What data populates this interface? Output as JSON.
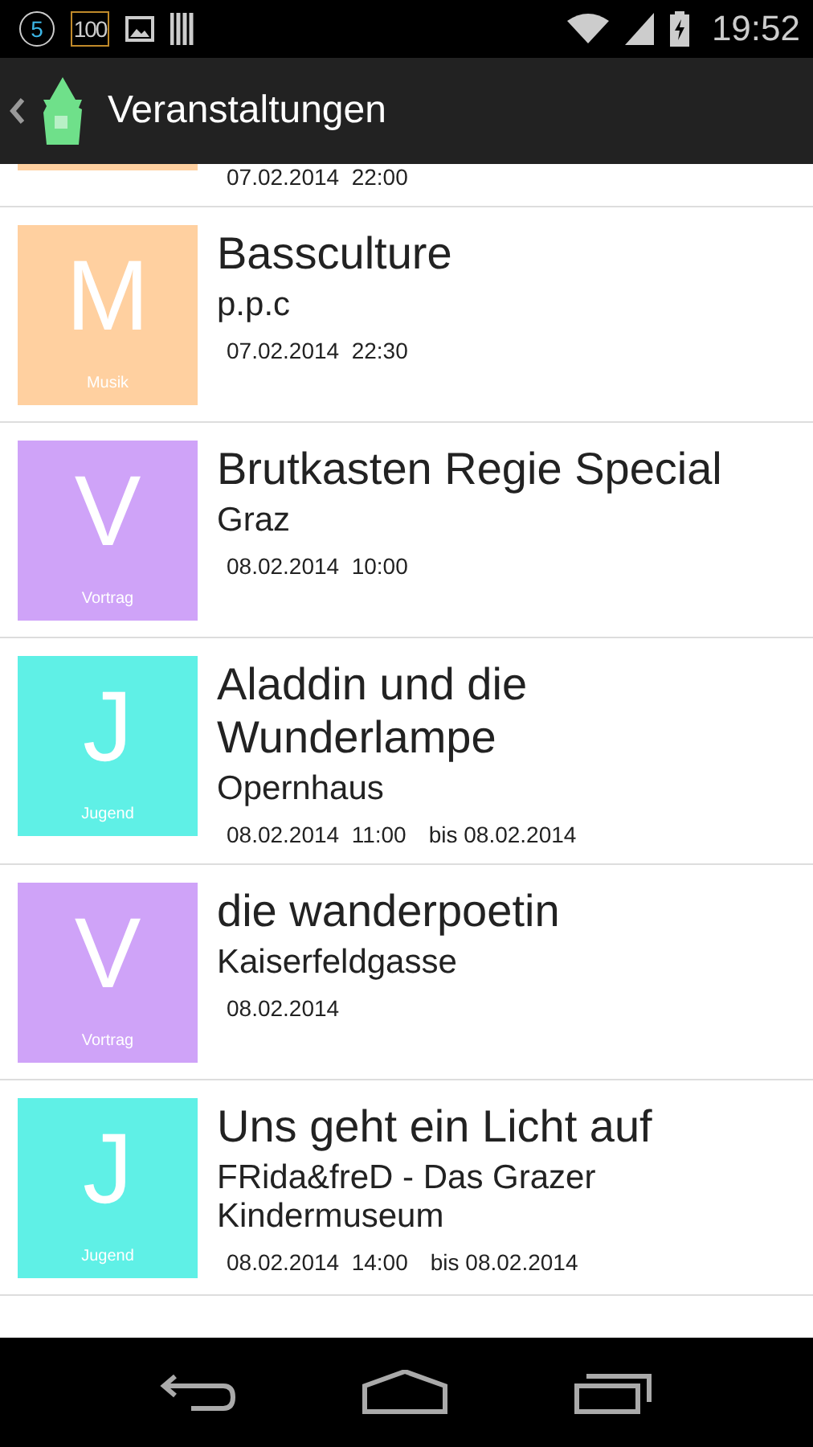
{
  "status_bar": {
    "badges": [
      "5",
      "100"
    ],
    "time": "19:52"
  },
  "action_bar": {
    "title": "Veranstaltungen"
  },
  "events": [
    {
      "kind": "partial",
      "color": "#ffd0a0",
      "date": "07.02.2014  22:00"
    },
    {
      "kind": "full",
      "color": "#ffd0a0",
      "letter": "M",
      "category": "Musik",
      "title": "Bassculture",
      "location": "p.p.c",
      "date": "07.02.2014  22:30"
    },
    {
      "kind": "full",
      "color": "#cfa3f8",
      "letter": "V",
      "category": "Vortrag",
      "title": "Brutkasten Regie Special",
      "location": "Graz",
      "date": "08.02.2014  10:00"
    },
    {
      "kind": "full",
      "color": "#5ff0e6",
      "letter": "J",
      "category": "Jugend",
      "title": "Aladdin und die Wunderlampe",
      "location": "Opernhaus",
      "date": "08.02.2014  11:00",
      "until": "bis 08.02.2014"
    },
    {
      "kind": "full",
      "color": "#cfa3f8",
      "letter": "V",
      "category": "Vortrag",
      "title": "die wanderpoetin",
      "location": "Kaiserfeldgasse",
      "date": "08.02.2014"
    },
    {
      "kind": "full",
      "color": "#5ff0e6",
      "letter": "J",
      "category": "Jugend",
      "title": "Uns geht ein Licht auf",
      "location": "FRida&freD - Das Grazer Kindermuseum",
      "date": "08.02.2014  14:00",
      "until": "bis 08.02.2014"
    }
  ]
}
